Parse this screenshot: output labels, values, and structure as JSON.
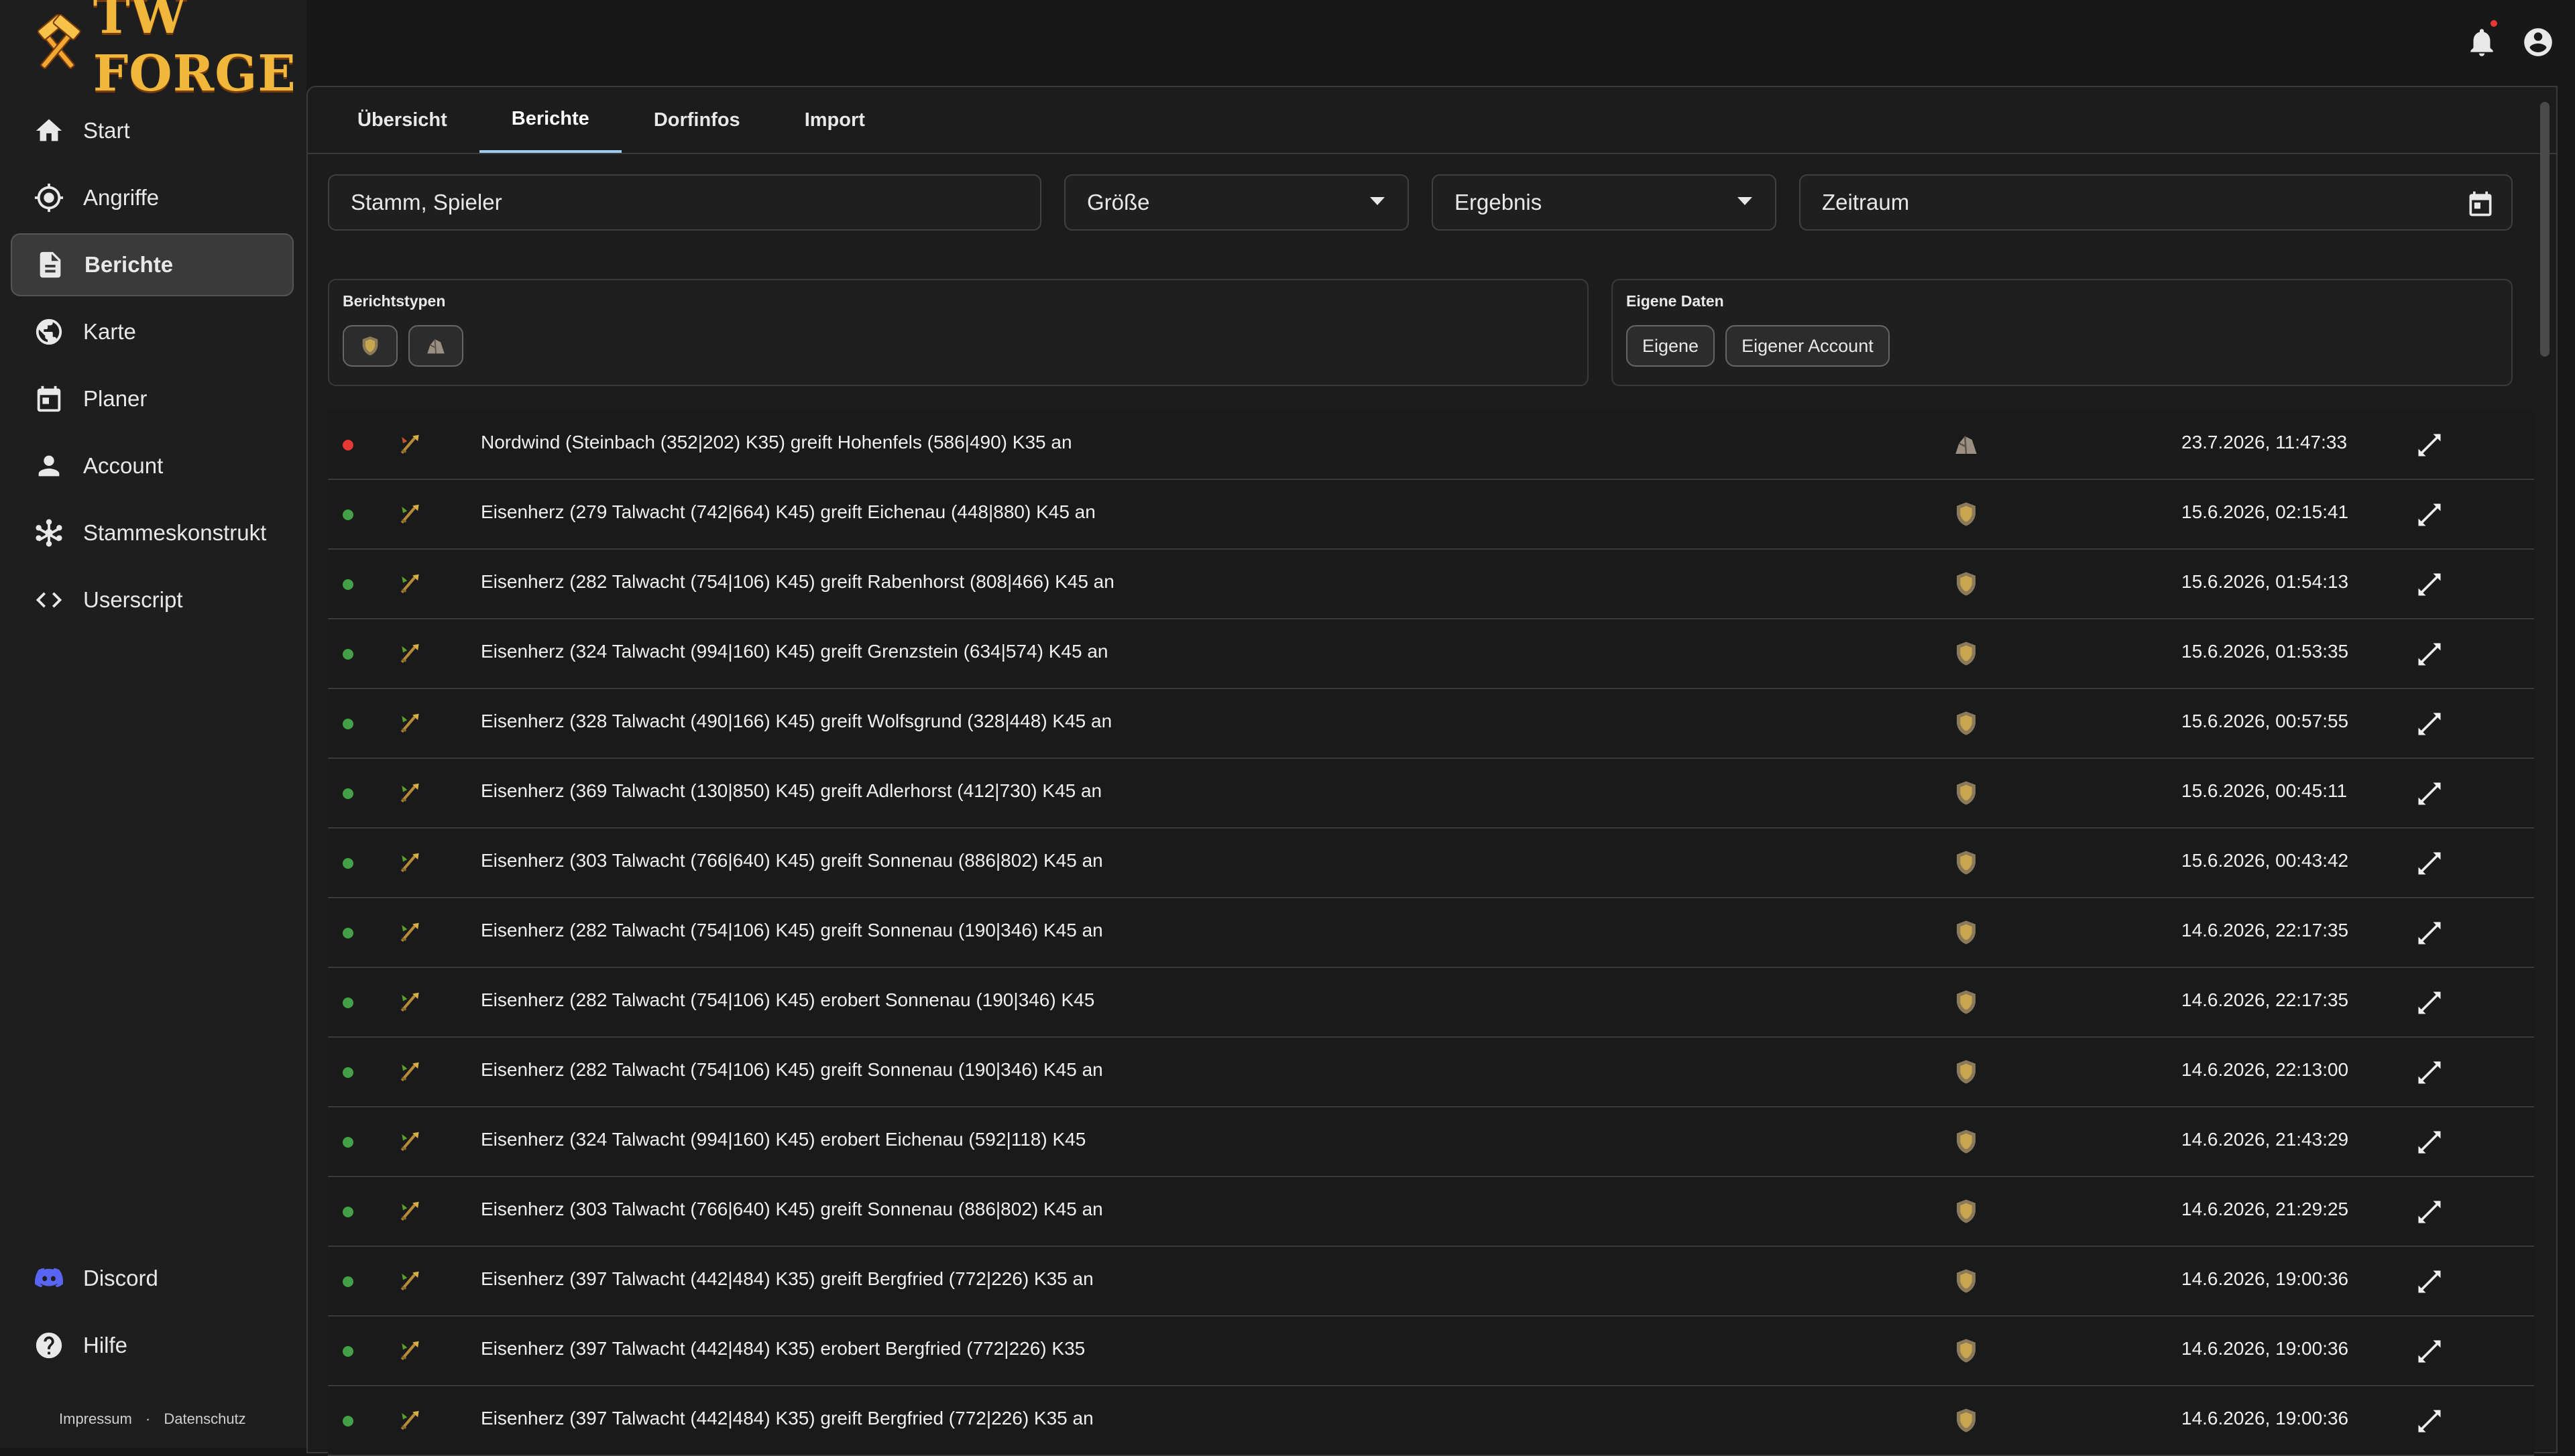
{
  "app": {
    "logo_text": "TW FORGE"
  },
  "colors": {
    "accent": "#9ecbf0",
    "logo": "#f0b73a",
    "dot_red": "#e53935",
    "dot_green": "#43a047"
  },
  "sidebar": {
    "items": [
      {
        "label": "Start",
        "icon": "home-icon"
      },
      {
        "label": "Angriffe",
        "icon": "target-icon"
      },
      {
        "label": "Berichte",
        "icon": "report-icon",
        "active": true
      },
      {
        "label": "Karte",
        "icon": "globe-icon"
      },
      {
        "label": "Planer",
        "icon": "calendar-icon"
      },
      {
        "label": "Account",
        "icon": "person-icon"
      },
      {
        "label": "Stammeskonstrukt",
        "icon": "network-icon"
      },
      {
        "label": "Userscript",
        "icon": "code-icon"
      }
    ],
    "bottom": [
      {
        "label": "Discord",
        "icon": "discord-icon"
      },
      {
        "label": "Hilfe",
        "icon": "help-icon"
      }
    ],
    "legal": {
      "impressum": "Impressum",
      "separator": "·",
      "datenschutz": "Datenschutz"
    }
  },
  "tabs": [
    {
      "label": "Übersicht"
    },
    {
      "label": "Berichte",
      "active": true
    },
    {
      "label": "Dorfinfos"
    },
    {
      "label": "Import"
    }
  ],
  "filters": {
    "search": "Stamm, Spieler",
    "size": "Größe",
    "result": "Ergebnis",
    "period": "Zeitraum"
  },
  "groups": {
    "types_title": "Berichtstypen",
    "own_title": "Eigene Daten",
    "own_chips": [
      "Eigene",
      "Eigener Account"
    ]
  },
  "rows": [
    {
      "status": "red",
      "title": "Nordwind (Steinbach (352|202) K35) greift Hohenfels (586|490) K35 an",
      "time": "23.7.2026, 11:47:33",
      "kind": "stone"
    },
    {
      "status": "green",
      "title": "Eisenherz (279 Talwacht (742|664) K45) greift Eichenau (448|880) K45 an",
      "time": "15.6.2026, 02:15:41",
      "kind": "shield"
    },
    {
      "status": "green",
      "title": "Eisenherz (282 Talwacht (754|106) K45) greift Rabenhorst (808|466) K45 an",
      "time": "15.6.2026, 01:54:13",
      "kind": "shield"
    },
    {
      "status": "green",
      "title": "Eisenherz (324 Talwacht (994|160) K45) greift Grenzstein (634|574) K45 an",
      "time": "15.6.2026, 01:53:35",
      "kind": "shield"
    },
    {
      "status": "green",
      "title": "Eisenherz (328 Talwacht (490|166) K45) greift Wolfsgrund (328|448) K45 an",
      "time": "15.6.2026, 00:57:55",
      "kind": "shield"
    },
    {
      "status": "green",
      "title": "Eisenherz (369 Talwacht (130|850) K45) greift Adlerhorst (412|730) K45 an",
      "time": "15.6.2026, 00:45:11",
      "kind": "shield"
    },
    {
      "status": "green",
      "title": "Eisenherz (303 Talwacht (766|640) K45) greift Sonnenau (886|802) K45 an",
      "time": "15.6.2026, 00:43:42",
      "kind": "shield"
    },
    {
      "status": "green",
      "title": "Eisenherz (282 Talwacht (754|106) K45) greift Sonnenau (190|346) K45 an",
      "time": "14.6.2026, 22:17:35",
      "kind": "shield"
    },
    {
      "status": "green",
      "title": "Eisenherz (282 Talwacht (754|106) K45) erobert Sonnenau (190|346) K45",
      "time": "14.6.2026, 22:17:35",
      "kind": "shield"
    },
    {
      "status": "green",
      "title": "Eisenherz (282 Talwacht (754|106) K45) greift Sonnenau (190|346) K45 an",
      "time": "14.6.2026, 22:13:00",
      "kind": "shield"
    },
    {
      "status": "green",
      "title": "Eisenherz (324 Talwacht (994|160) K45) erobert Eichenau (592|118) K45",
      "time": "14.6.2026, 21:43:29",
      "kind": "shield"
    },
    {
      "status": "green",
      "title": "Eisenherz (303 Talwacht (766|640) K45) greift Sonnenau (886|802) K45 an",
      "time": "14.6.2026, 21:29:25",
      "kind": "shield"
    },
    {
      "status": "green",
      "title": "Eisenherz (397 Talwacht (442|484) K35) greift Bergfried (772|226) K35 an",
      "time": "14.6.2026, 19:00:36",
      "kind": "shield"
    },
    {
      "status": "green",
      "title": "Eisenherz (397 Talwacht (442|484) K35) erobert Bergfried (772|226) K35",
      "time": "14.6.2026, 19:00:36",
      "kind": "shield"
    },
    {
      "status": "green",
      "title": "Eisenherz (397 Talwacht (442|484) K35) greift Bergfried (772|226) K35 an",
      "time": "14.6.2026, 19:00:36",
      "kind": "shield"
    }
  ]
}
